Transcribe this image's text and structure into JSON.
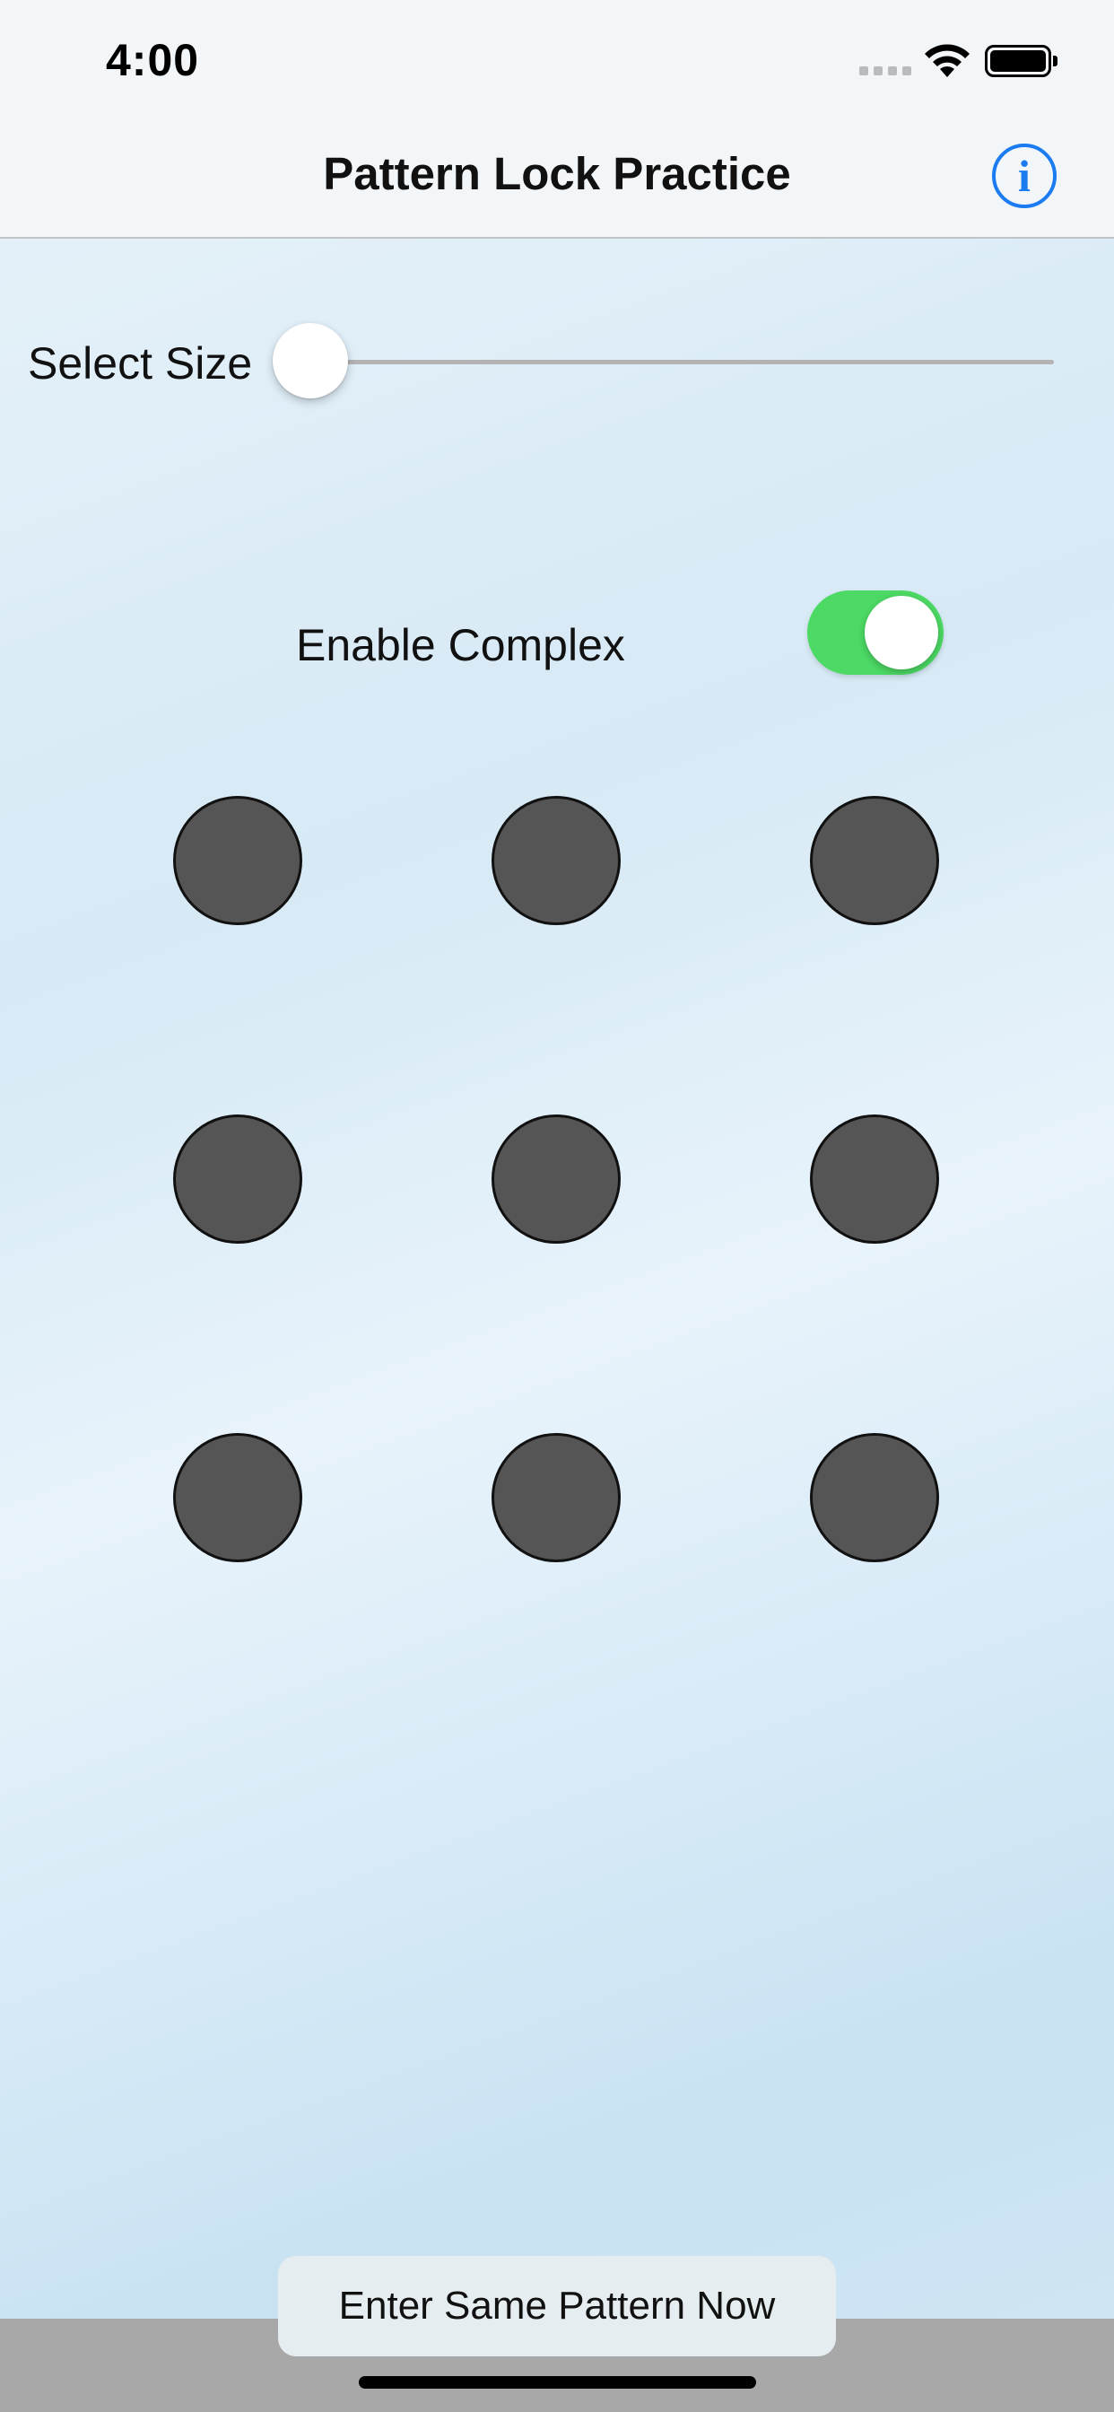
{
  "status_bar": {
    "time": "4:00",
    "icons": [
      "cellular-signal-icon",
      "wifi-icon",
      "battery-icon"
    ]
  },
  "nav": {
    "title": "Pattern Lock Practice",
    "info_icon": "info-icon",
    "info_glyph": "i"
  },
  "size_slider": {
    "label": "Select Size",
    "value_fraction": 0.0
  },
  "complex_toggle": {
    "label": "Enable Complex",
    "on": true
  },
  "pattern_grid": {
    "rows": 3,
    "cols": 3,
    "dot_color": "#555555"
  },
  "bottom": {
    "button_label": "Enter Same Pattern Now"
  },
  "colors": {
    "accent": "#1a7cf0",
    "toggle_on": "#4cd964"
  }
}
